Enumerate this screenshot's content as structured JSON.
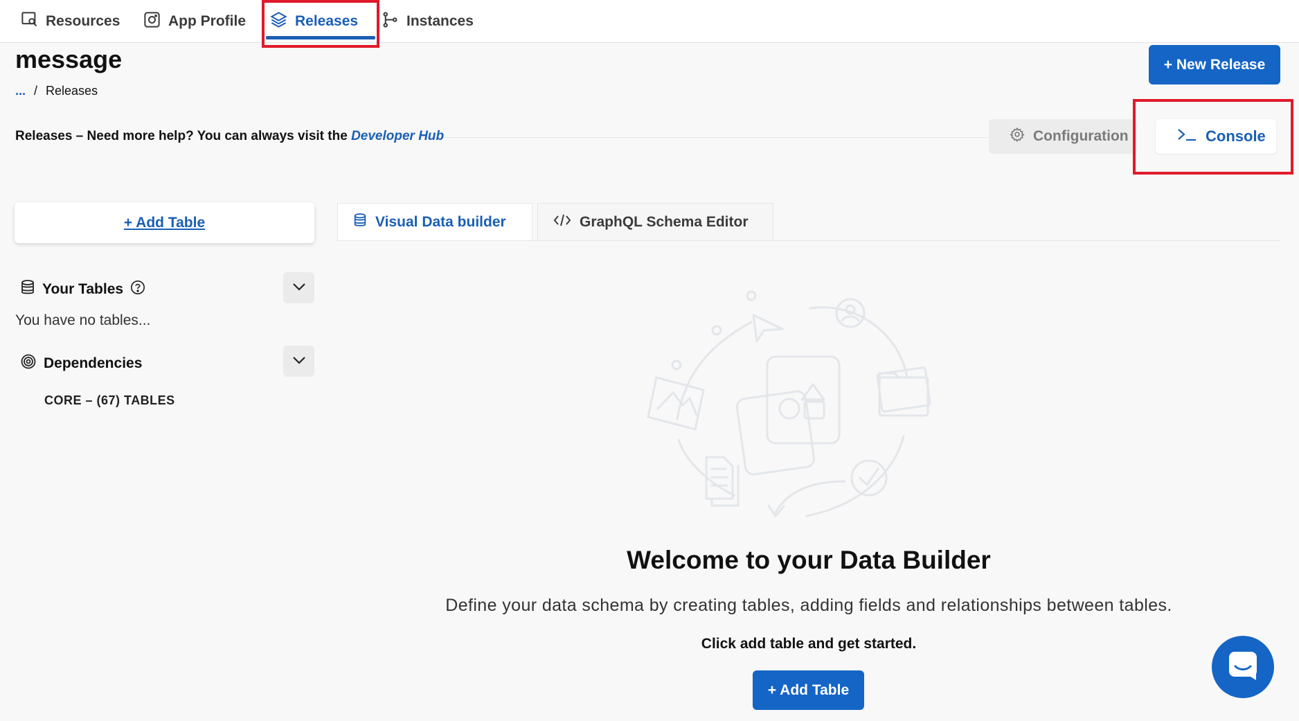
{
  "nav": {
    "tabs": [
      {
        "label": "Resources",
        "icon": "resources-icon"
      },
      {
        "label": "App Profile",
        "icon": "app-profile-icon"
      },
      {
        "label": "Releases",
        "icon": "layers-icon",
        "active": true
      },
      {
        "label": "Instances",
        "icon": "branch-icon"
      }
    ]
  },
  "header": {
    "title": "message",
    "breadcrumb": {
      "root": "...",
      "separator": "/",
      "current": "Releases"
    },
    "new_release_label": "+ New Release"
  },
  "help": {
    "text": "Releases – Need more help? You can always visit the",
    "link": "Developer Hub"
  },
  "actions": {
    "configuration_label": "Configuration",
    "console_label": "Console"
  },
  "sidebar": {
    "add_table_label": "+ Add Table",
    "your_tables_label": "Your Tables",
    "no_tables_text": "You have no tables...",
    "dependencies_label": "Dependencies",
    "core_tables": "CORE – (67) TABLES"
  },
  "main": {
    "tabs": [
      {
        "label": "Visual Data builder",
        "icon": "database-icon",
        "active": true
      },
      {
        "label": "GraphQL Schema Editor",
        "icon": "code-icon"
      }
    ],
    "welcome_title": "Welcome to your Data Builder",
    "welcome_subtitle": "Define your data schema by creating tables, adding fields and relationships between tables.",
    "welcome_cta": "Click add table and get started.",
    "add_table_button": "+ Add Table"
  },
  "colors": {
    "accent": "#1465c6",
    "link": "#1a5fb4",
    "highlight": "#e0192a"
  }
}
